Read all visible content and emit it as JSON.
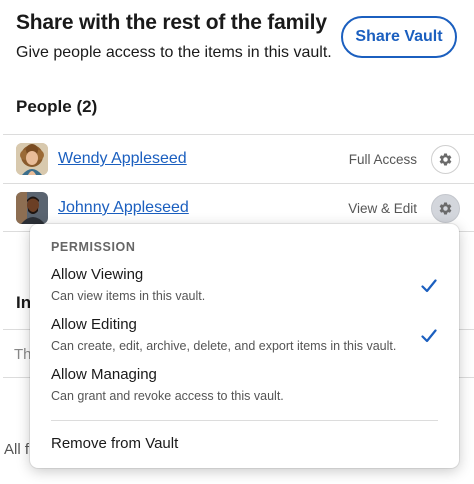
{
  "header": {
    "title": "Share with the rest of the family",
    "subtitle": "Give people access to the items in this vault.",
    "share_button_label": "Share Vault"
  },
  "people": {
    "heading": "People (2)",
    "items": [
      {
        "name": "Wendy Appleseed",
        "access": "Full Access"
      },
      {
        "name": "Johnny Appleseed",
        "access": "View & Edit"
      }
    ]
  },
  "background": {
    "heading_partial": "In",
    "text_partial": "Th",
    "footer_partial": "All f"
  },
  "permission_menu": {
    "header": "PERMISSION",
    "options": [
      {
        "title": "Allow Viewing",
        "description": "Can view items in this vault.",
        "checked": true
      },
      {
        "title": "Allow Editing",
        "description": "Can create, edit, archive, delete, and export items in this vault.",
        "checked": true
      },
      {
        "title": "Allow Managing",
        "description": "Can grant and revoke access to this vault.",
        "checked": false
      }
    ],
    "remove_label": "Remove from Vault"
  },
  "colors": {
    "accent": "#1b5fbf",
    "divider": "#dcdcdc",
    "gear_active_bg": "#d3d6dc"
  },
  "icons": {
    "gear": "gear-icon",
    "check": "checkmark-icon"
  }
}
